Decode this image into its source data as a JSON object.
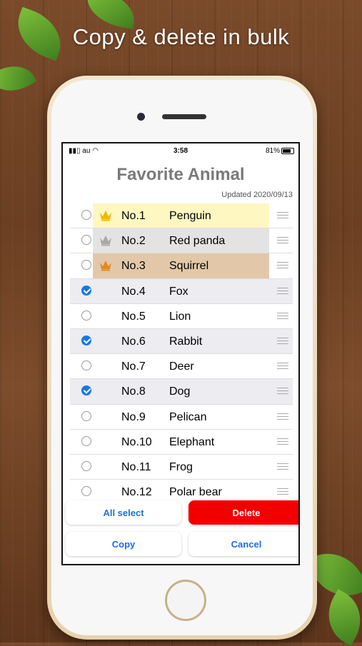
{
  "headline": "Copy & delete in bulk",
  "status_bar": {
    "carrier": "au",
    "time": "3:58",
    "battery": "81%"
  },
  "screen": {
    "title": "Favorite Animal",
    "updated": "Updated 2020/09/13"
  },
  "rows": [
    {
      "number": "No.1",
      "name": "Penguin",
      "checked": false,
      "crown": "gold",
      "highlight": "#fff7c2"
    },
    {
      "number": "No.2",
      "name": "Red panda",
      "checked": false,
      "crown": "silver",
      "highlight": "#e3e3e3"
    },
    {
      "number": "No.3",
      "name": "Squirrel",
      "checked": false,
      "crown": "bronze",
      "highlight": "#e2c8a8"
    },
    {
      "number": "No.4",
      "name": "Fox",
      "checked": true,
      "crown": null,
      "highlight": null
    },
    {
      "number": "No.5",
      "name": "Lion",
      "checked": false,
      "crown": null,
      "highlight": null
    },
    {
      "number": "No.6",
      "name": "Rabbit",
      "checked": true,
      "crown": null,
      "highlight": null
    },
    {
      "number": "No.7",
      "name": "Deer",
      "checked": false,
      "crown": null,
      "highlight": null
    },
    {
      "number": "No.8",
      "name": "Dog",
      "checked": true,
      "crown": null,
      "highlight": null
    },
    {
      "number": "No.9",
      "name": "Pelican",
      "checked": false,
      "crown": null,
      "highlight": null
    },
    {
      "number": "No.10",
      "name": "Elephant",
      "checked": false,
      "crown": null,
      "highlight": null
    },
    {
      "number": "No.11",
      "name": "Frog",
      "checked": false,
      "crown": null,
      "highlight": null
    },
    {
      "number": "No.12",
      "name": "Polar bear",
      "checked": false,
      "crown": null,
      "highlight": null
    }
  ],
  "buttons": {
    "all_select": "All select",
    "delete": "Delete",
    "copy": "Copy",
    "cancel": "Cancel"
  },
  "colors": {
    "checked_blue": "#1677e6",
    "delete_red": "#f20000",
    "crown_gold": "#f2b705",
    "crown_silver": "#a8a8a8",
    "crown_bronze": "#e08a1e"
  }
}
